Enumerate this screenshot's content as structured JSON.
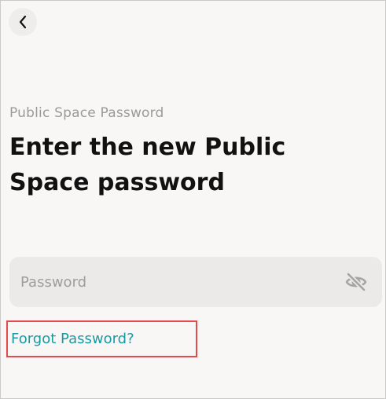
{
  "header": {
    "back_icon": "chevron-left-icon"
  },
  "content": {
    "subtitle": "Public Space Password",
    "headline": "Enter the new Public Space password"
  },
  "password_field": {
    "placeholder": "Password",
    "value": "",
    "visibility_icon": "eye-off-icon"
  },
  "links": {
    "forgot_password": "Forgot Password?"
  },
  "colors": {
    "link": "#189aa3",
    "highlight_border": "#e14b4b",
    "background": "#f8f7f6",
    "field_background": "#ebeae9"
  }
}
